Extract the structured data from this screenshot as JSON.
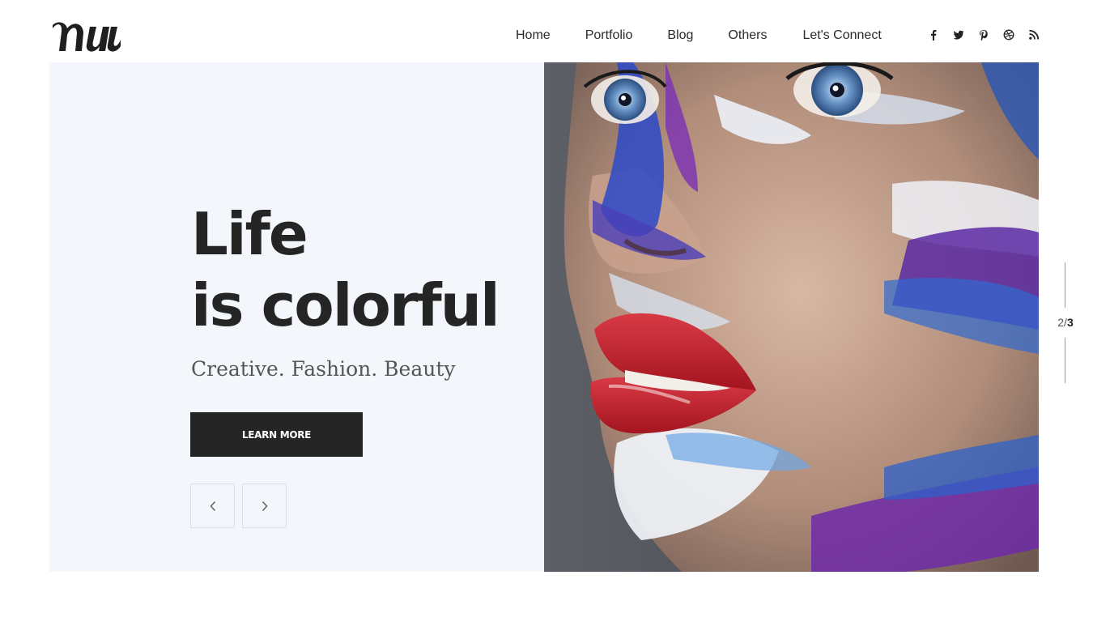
{
  "nav": {
    "items": [
      {
        "label": "Home"
      },
      {
        "label": "Portfolio"
      },
      {
        "label": "Blog"
      },
      {
        "label": "Others"
      },
      {
        "label": "Let's Connect"
      }
    ]
  },
  "social": {
    "icons": [
      "facebook-icon",
      "twitter-icon",
      "pinterest-icon",
      "dribbble-icon",
      "rss-icon"
    ]
  },
  "hero": {
    "headline_line1": "Life",
    "headline_line2": "is colorful",
    "subline": "Creative. Fashion. Beauty",
    "cta_label": "LEARN MORE",
    "image_description": "Close-up portrait with blue, purple and white face paint and red lips"
  },
  "slider": {
    "current": "2",
    "separator": "/",
    "total": "3"
  },
  "colors": {
    "background": "#ffffff",
    "hero_left_bg": "#f3f6fb",
    "text_dark": "#252525",
    "button_bg": "#252525",
    "button_text": "#ffffff"
  }
}
